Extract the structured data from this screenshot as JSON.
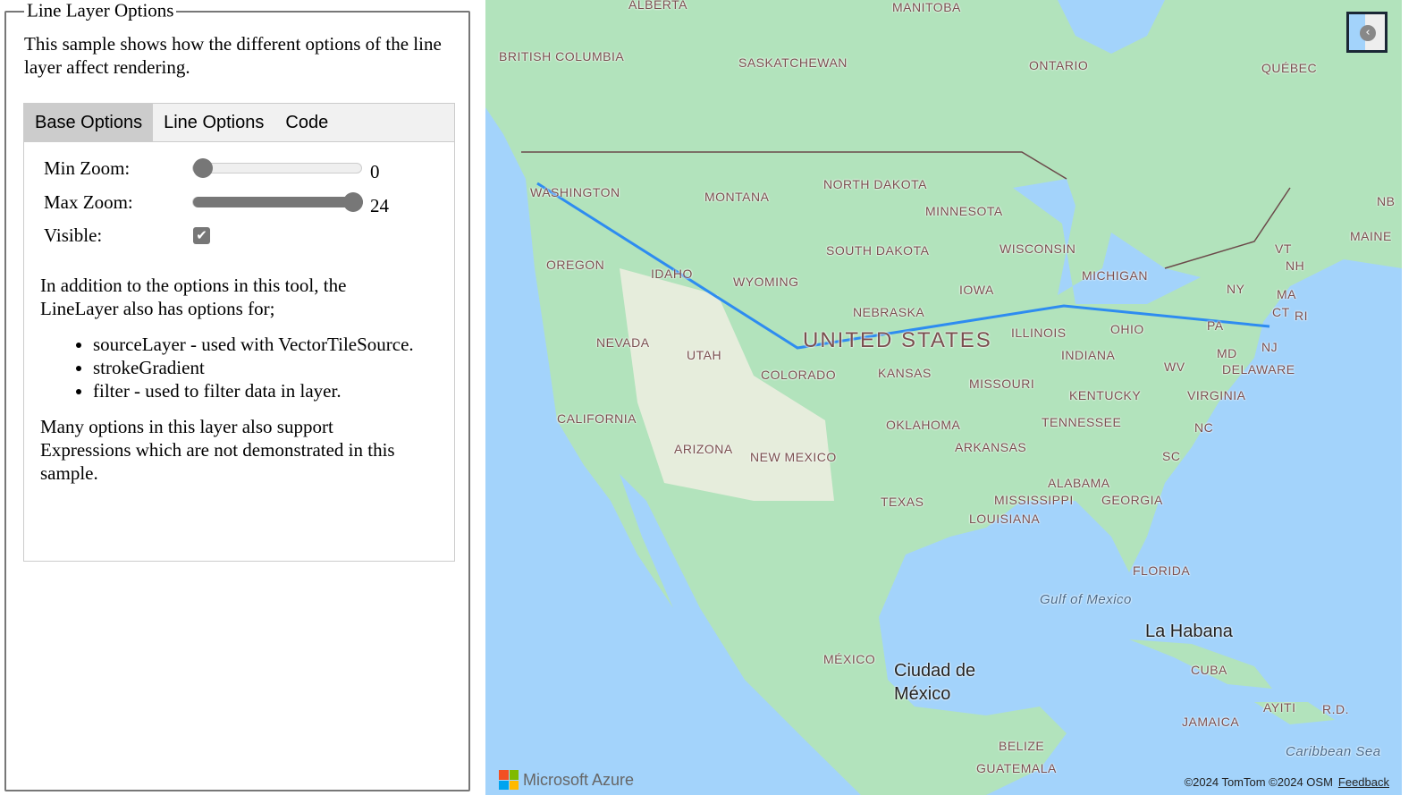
{
  "panel": {
    "title": "Line Layer Options",
    "description": "This sample shows how the different options of the line layer affect rendering.",
    "tabs": [
      {
        "label": "Base Options",
        "active": true
      },
      {
        "label": "Line Options"
      },
      {
        "label": "Code"
      }
    ],
    "min_zoom": {
      "label": "Min Zoom:",
      "value": "0"
    },
    "max_zoom": {
      "label": "Max Zoom:",
      "value": "24"
    },
    "visible": {
      "label": "Visible:",
      "checked": true
    },
    "para1": "In addition to the options in this tool, the LineLayer also has options for;",
    "bullets": [
      "sourceLayer - used with VectorTileSource.",
      "strokeGradient",
      "filter - used to filter data in layer."
    ],
    "para2": "Many options in this layer also support Expressions which are not demonstrated in this sample."
  },
  "map": {
    "labels": [
      "ALBERTA",
      "MANITOBA",
      "BRITISH COLUMBIA",
      "SASKATCHEWAN",
      "ONTARIO",
      "QUÉBEC",
      "WASHINGTON",
      "MONTANA",
      "NORTH DAKOTA",
      "MINNESOTA",
      "NB",
      "OREGON",
      "IDAHO",
      "WYOMING",
      "SOUTH DAKOTA",
      "WISCONSIN",
      "MICHIGAN",
      "VT",
      "MAINE",
      "NH",
      "NY",
      "MA",
      "CT",
      "RI",
      "IOWA",
      "NEBRASKA",
      "NEVADA",
      "UTAH",
      "ILLINOIS",
      "OHIO",
      "PA",
      "NJ",
      "INDIANA",
      "MD",
      "DELAWARE",
      "WV",
      "COLORADO",
      "KANSAS",
      "MISSOURI",
      "KENTUCKY",
      "VIRGINIA",
      "CALIFORNIA",
      "OKLAHOMA",
      "TENNESSEE",
      "NC",
      "ARKANSAS",
      "ARIZONA",
      "NEW MEXICO",
      "SC",
      "ALABAMA",
      "MISSISSIPPI",
      "GEORGIA",
      "TEXAS",
      "LOUISIANA",
      "FLORIDA",
      "MÉXICO",
      "CUBA",
      "JAMAICA",
      "AYITI",
      "R.D.",
      "BELIZE",
      "GUATEMALA"
    ],
    "country_label": "UNITED STATES",
    "cities": [
      "La Habana",
      "Ciudad de México"
    ],
    "seas": [
      "Gulf of Mexico",
      "Caribbean Sea"
    ],
    "line_color": "#2e8cf0",
    "attribution": "©2024 TomTom  ©2024 OSM",
    "feedback": "Feedback",
    "logo": "Microsoft Azure",
    "overview_icon": "chevron-left-icon"
  }
}
